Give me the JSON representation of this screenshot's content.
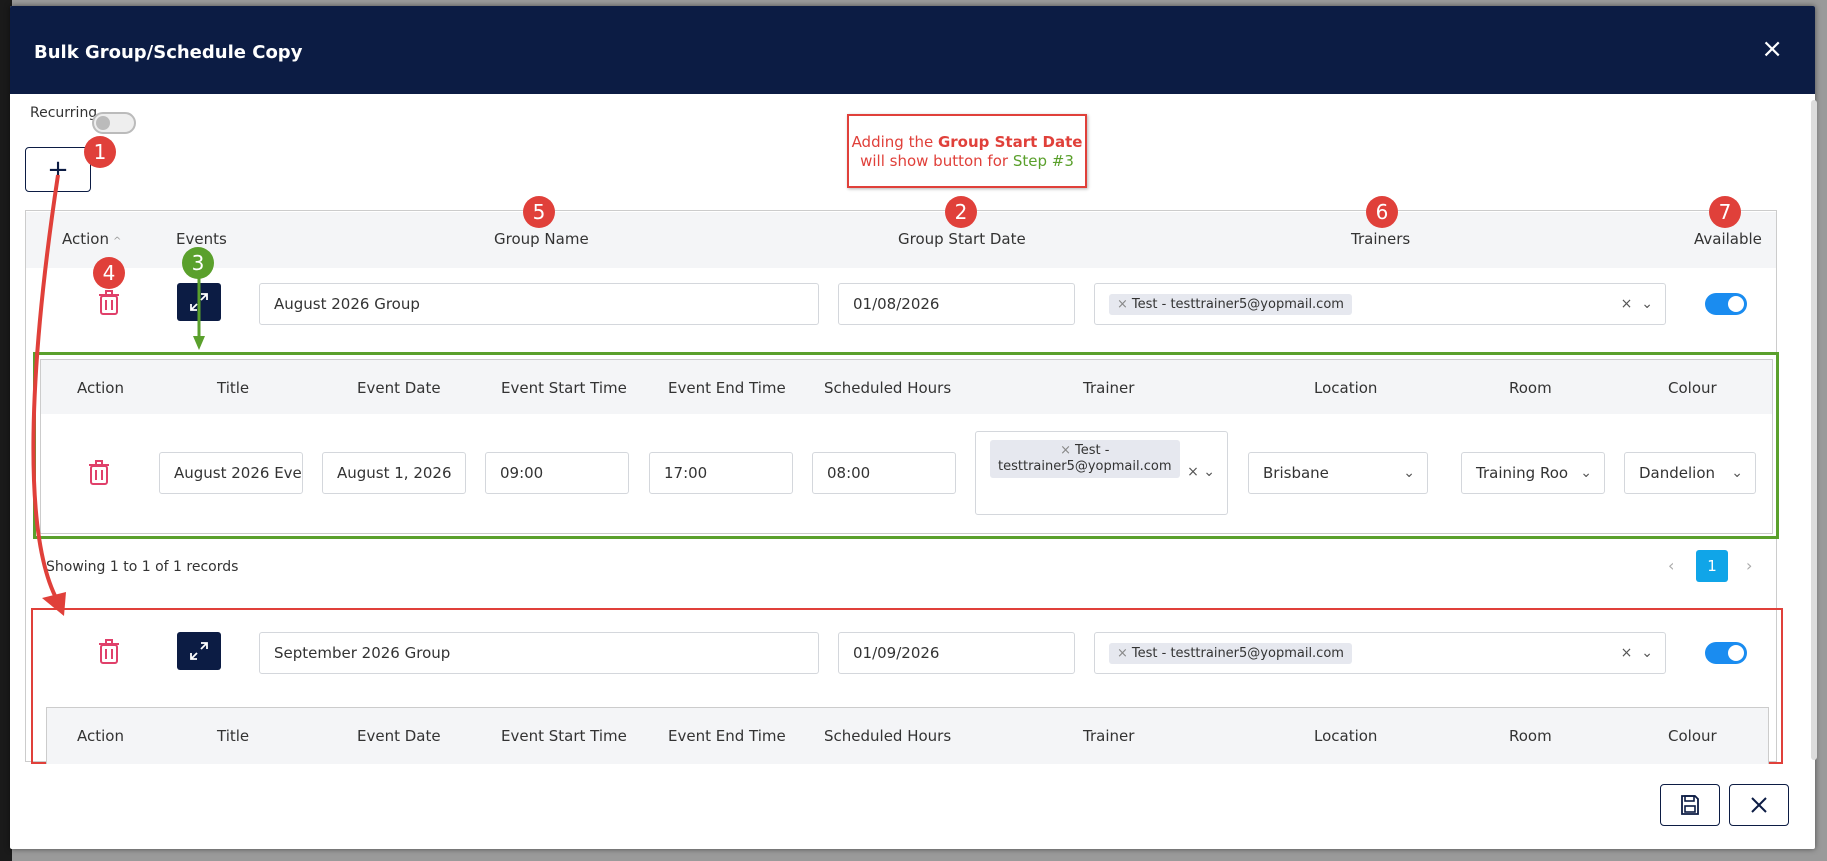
{
  "modal": {
    "title": "Bulk Group/Schedule Copy",
    "close_icon": "×"
  },
  "recurring": {
    "label": "Recurring",
    "enabled": false
  },
  "add_button": {
    "icon": "+"
  },
  "callout": {
    "line1_pre": "Adding the ",
    "line1_bold": "Group Start Date",
    "line2_pre": "will show button for ",
    "line2_step": "Step #3"
  },
  "badges": [
    "1",
    "2",
    "3",
    "4",
    "5",
    "6",
    "7"
  ],
  "group_table": {
    "headers": {
      "action": "Action",
      "events": "Events",
      "group_name": "Group Name",
      "group_start_date": "Group Start Date",
      "trainers": "Trainers",
      "available": "Available"
    },
    "rows": [
      {
        "group_name": "August 2026 Group",
        "start_date": "01/08/2026",
        "trainer_chip": "Test - testtrainer5@yopmail.com",
        "available": true
      },
      {
        "group_name": "September 2026 Group",
        "start_date": "01/09/2026",
        "trainer_chip": "Test - testtrainer5@yopmail.com",
        "available": true
      }
    ]
  },
  "event_table": {
    "headers": {
      "action": "Action",
      "title": "Title",
      "event_date": "Event Date",
      "event_start_time": "Event Start Time",
      "event_end_time": "Event End Time",
      "scheduled_hours": "Scheduled Hours",
      "trainer": "Trainer",
      "location": "Location",
      "room": "Room",
      "colour": "Colour"
    },
    "row": {
      "title": "August 2026 Eve",
      "event_date": "August 1, 2026",
      "start_time": "09:00",
      "end_time": "17:00",
      "scheduled_hours": "08:00",
      "trainer_chip_line1": "Test -",
      "trainer_chip_line2": "testtrainer5@yopmail.com",
      "location": "Brisbane",
      "room": "Training Roo",
      "colour": "Dandelion"
    }
  },
  "pager": {
    "text": "Showing 1 to 1 of 1 records",
    "page": "1",
    "prev": "‹",
    "next": "›"
  },
  "colors": {
    "header_bg": "#0c1c44",
    "accent_blue": "#1a8cf0",
    "annotation_red": "#e0403a",
    "annotation_green": "#5aa02c",
    "page_active": "#10a5e8"
  },
  "icons": {
    "trash": "trash-icon",
    "expand": "expand-icon",
    "save": "save-icon",
    "cancel": "close-icon",
    "chevron": "chevron-down-icon"
  }
}
